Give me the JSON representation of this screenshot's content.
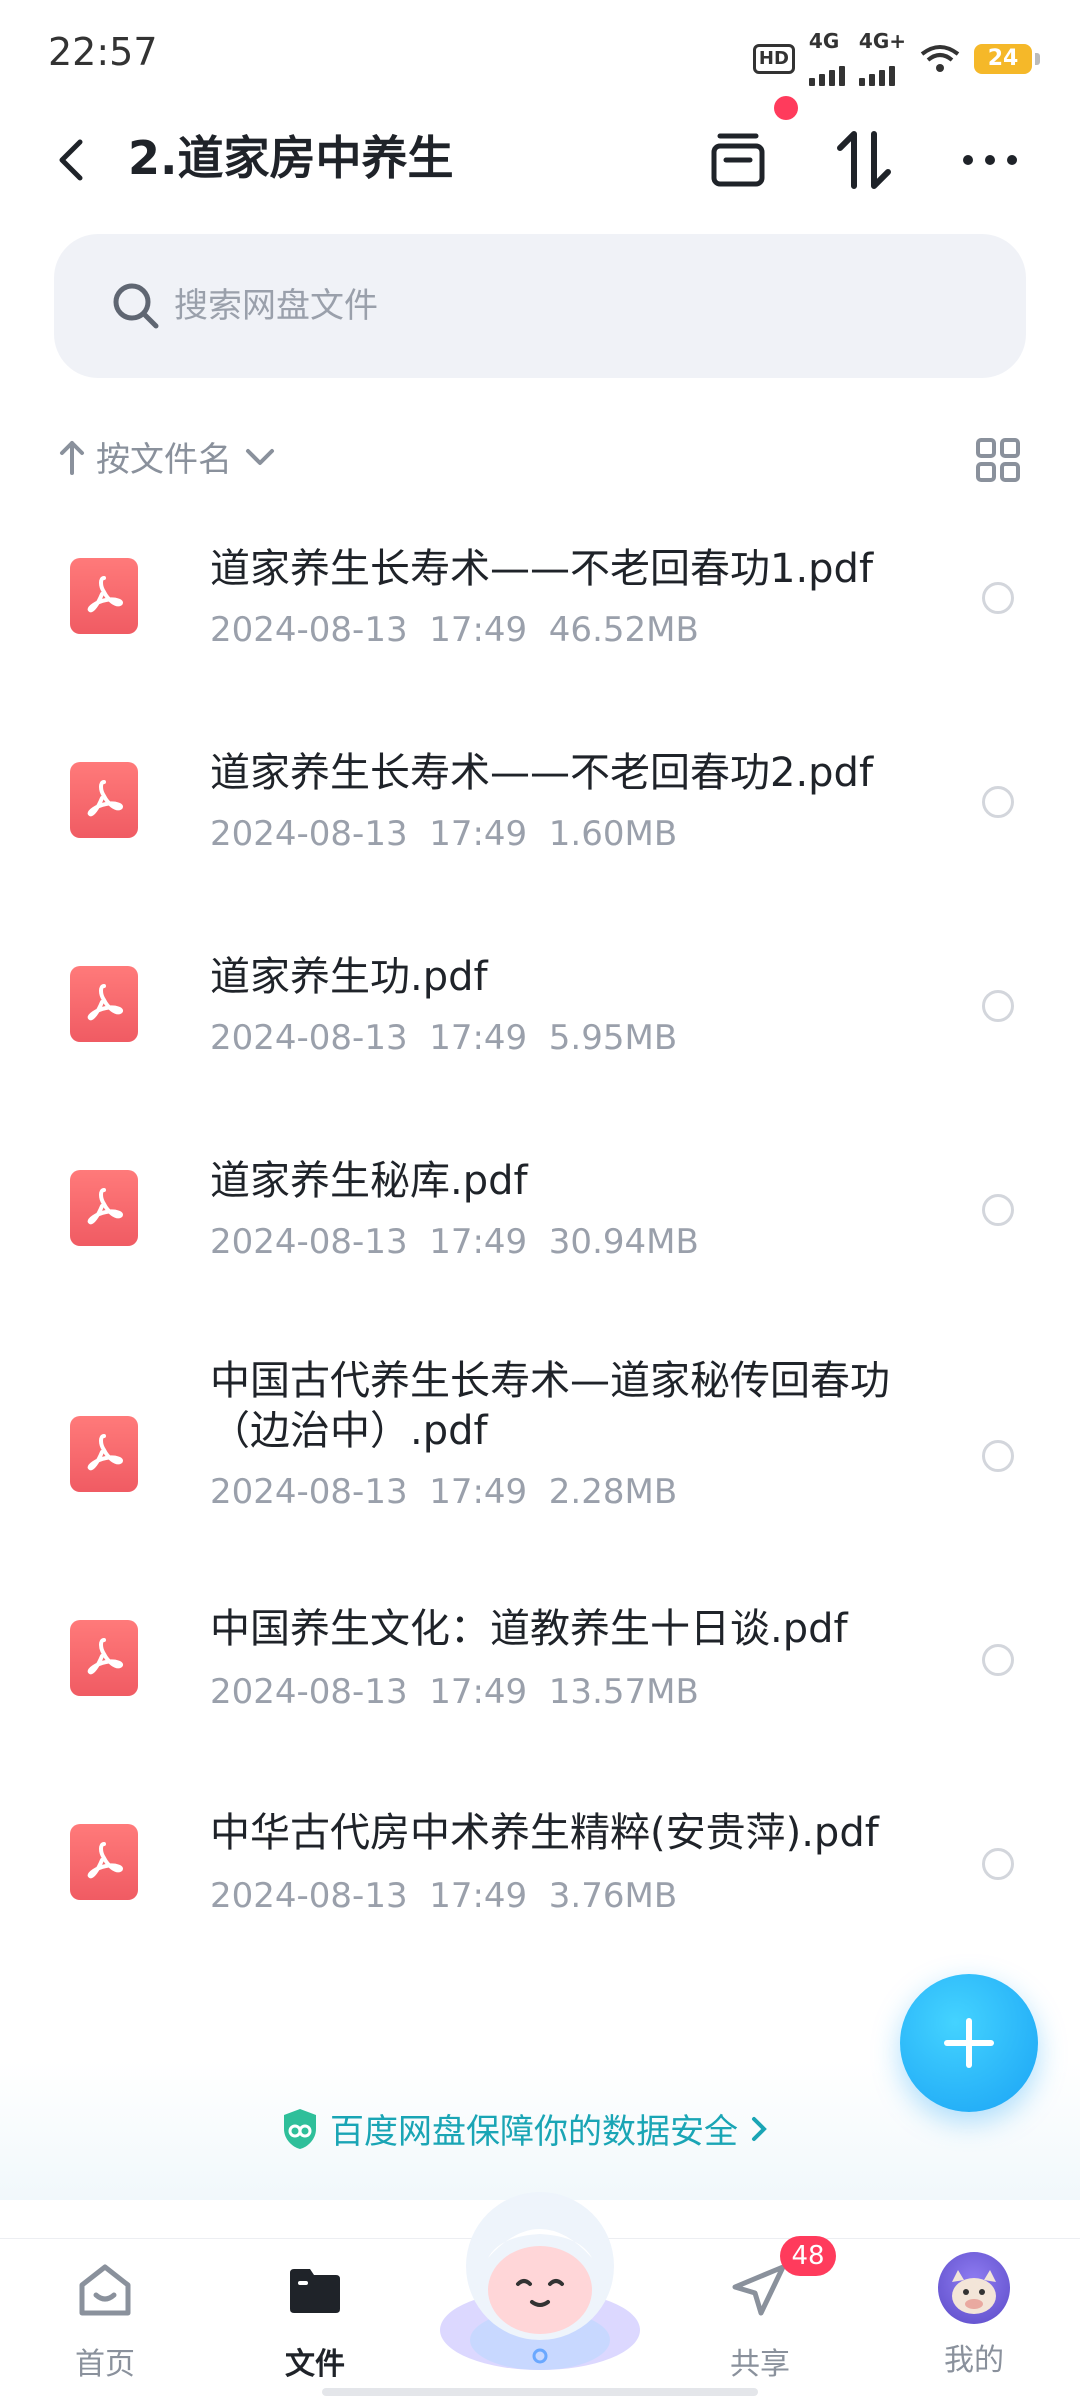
{
  "status_bar": {
    "time": "22:57",
    "hd": "HD",
    "net1": "4G",
    "net2": "4G+",
    "battery": "24"
  },
  "header": {
    "title": "2.道家房中养生"
  },
  "search": {
    "placeholder": "搜索网盘文件"
  },
  "sort": {
    "label": "按文件名"
  },
  "files": [
    {
      "name": "道家养生长寿术——不老回春功1.pdf",
      "meta": "2024-08-13  17:49  46.52MB"
    },
    {
      "name": "道家养生长寿术——不老回春功2.pdf",
      "meta": "2024-08-13  17:49  1.60MB"
    },
    {
      "name": "道家养生功.pdf",
      "meta": "2024-08-13  17:49  5.95MB"
    },
    {
      "name": "道家养生秘库.pdf",
      "meta": "2024-08-13  17:49  30.94MB"
    },
    {
      "name": "中国古代养生长寿术—道家秘传回春功（边治中）.pdf",
      "meta": "2024-08-13  17:49  2.28MB"
    },
    {
      "name": "中国养生文化：道教养生十日谈.pdf",
      "meta": "2024-08-13  17:49  13.57MB"
    },
    {
      "name": "中华古代房中术养生精粹(安贵萍).pdf",
      "meta": "2024-08-13  17:49  3.76MB"
    }
  ],
  "safety_banner": {
    "text": "百度网盘保障你的数据安全"
  },
  "tabs": [
    {
      "label": "首页",
      "icon": "home-icon"
    },
    {
      "label": "文件",
      "icon": "folder-icon"
    },
    {
      "label": "共享",
      "icon": "send-icon"
    },
    {
      "label": "我的",
      "icon": "avatar-icon"
    }
  ],
  "share_badge": "48",
  "colors": {
    "accent": "#1aa3f5",
    "pdf": "#f05b63",
    "badge": "#ff3b5c",
    "safety": "#1aa5b5"
  }
}
